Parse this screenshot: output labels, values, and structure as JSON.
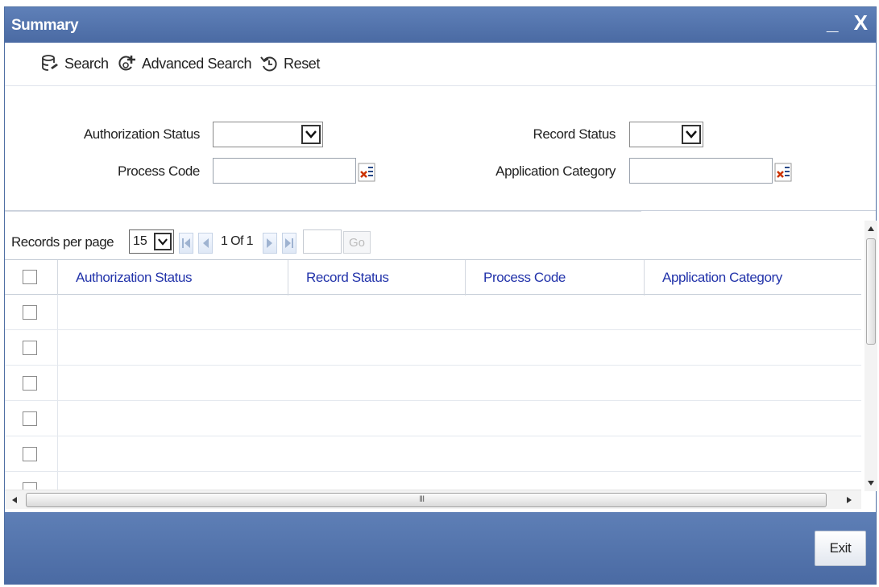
{
  "window": {
    "title": "Summary",
    "minimize_glyph": "_",
    "close_glyph": "X"
  },
  "toolbar": {
    "search_label": "Search",
    "advanced_search_label": "Advanced Search",
    "reset_label": "Reset",
    "search_icon": "database-search-icon",
    "advanced_search_icon": "add-search-icon",
    "reset_icon": "reset-icon"
  },
  "criteria": {
    "authorization_status_label": "Authorization Status",
    "authorization_status_value": "",
    "record_status_label": "Record Status",
    "record_status_value": "",
    "process_code_label": "Process Code",
    "process_code_value": "",
    "application_category_label": "Application Category",
    "application_category_value": ""
  },
  "pager": {
    "records_per_page_label": "Records per page",
    "records_per_page_value": "15",
    "page_info": "1 Of 1",
    "goto_value": "",
    "go_label": "Go"
  },
  "table": {
    "columns": [
      "Authorization Status",
      "Record Status",
      "Process Code",
      "Application Category"
    ],
    "visible_empty_rows": 6
  },
  "scrollbar": {
    "grip": "III"
  },
  "footer": {
    "exit_label": "Exit"
  },
  "colors": {
    "title_bar": "#4f70a8",
    "column_header_text": "#2233aa",
    "lov_icon": "#cc3300"
  }
}
